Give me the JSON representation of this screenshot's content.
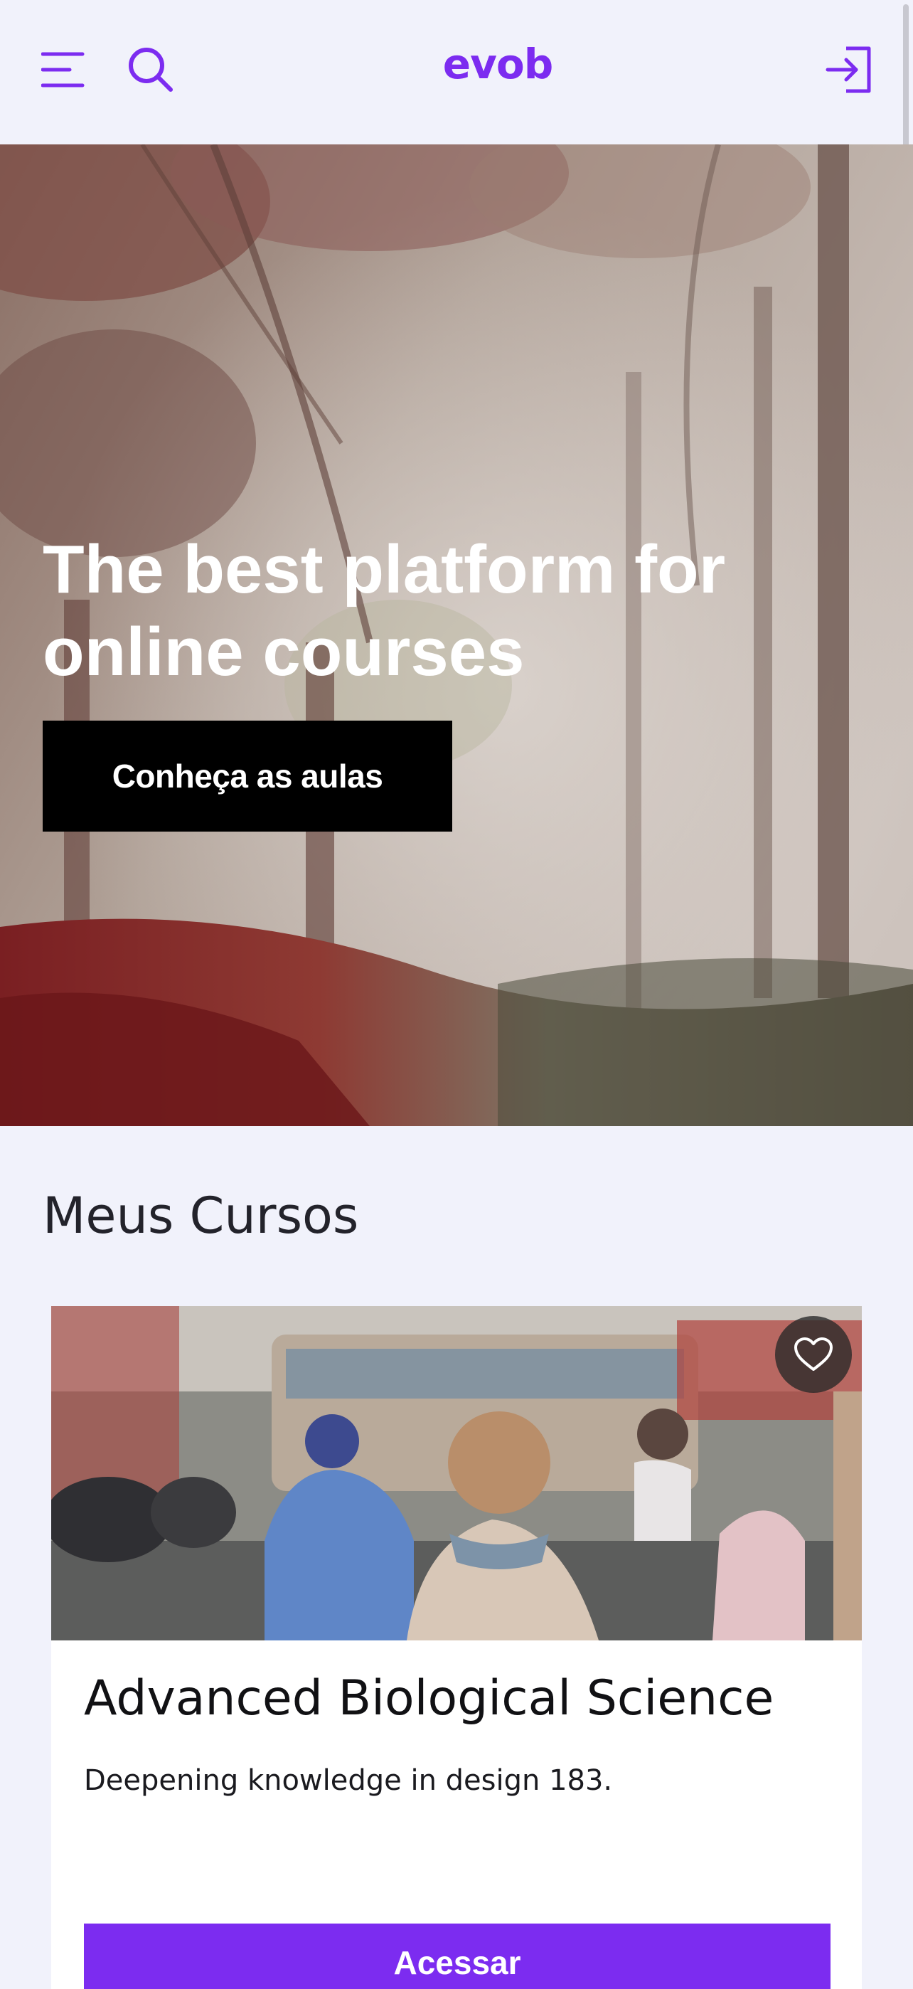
{
  "header": {
    "logo_text": "evob",
    "icons": {
      "menu": "menu-icon",
      "search": "search-icon",
      "login": "login-icon"
    },
    "accent_color": "#7c2cf0"
  },
  "hero": {
    "title": "The best platform for online courses",
    "cta_label": "Conheça as aulas"
  },
  "courses": {
    "section_title": "Meus Cursos",
    "items": [
      {
        "title": "Advanced Biological Science",
        "description": "Deepening knowledge in design 183.",
        "cta_label": "Acessar",
        "favorite_icon": "heart-icon"
      }
    ]
  }
}
